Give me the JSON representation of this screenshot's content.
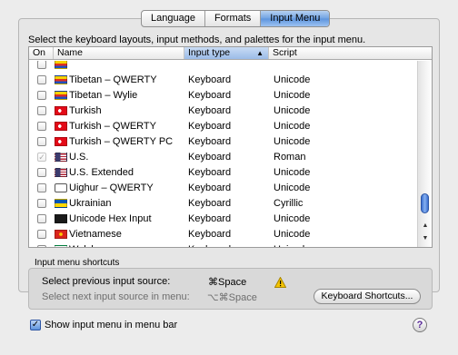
{
  "tabs": [
    {
      "label": "Language",
      "active": false
    },
    {
      "label": "Formats",
      "active": false
    },
    {
      "label": "Input Menu",
      "active": true
    }
  ],
  "instructions": "Select the keyboard layouts, input methods, and palettes for the input menu.",
  "table": {
    "columns": {
      "on": "On",
      "name": "Name",
      "input_type": "Input type",
      "script": "Script"
    },
    "sorted_column": "input_type",
    "rows": [
      {
        "checked": false,
        "disabled": false,
        "flag": "tibetan-flag-icon",
        "name": "",
        "input_type": "",
        "script": ""
      },
      {
        "checked": false,
        "disabled": false,
        "flag": "tibetan-flag-icon",
        "name": "Tibetan – QWERTY",
        "input_type": "Keyboard",
        "script": "Unicode"
      },
      {
        "checked": false,
        "disabled": false,
        "flag": "tibetan-flag-icon",
        "name": "Tibetan – Wylie",
        "input_type": "Keyboard",
        "script": "Unicode"
      },
      {
        "checked": false,
        "disabled": false,
        "flag": "turkey-flag-icon",
        "name": "Turkish",
        "input_type": "Keyboard",
        "script": "Unicode"
      },
      {
        "checked": false,
        "disabled": false,
        "flag": "turkey-flag-icon",
        "name": "Turkish – QWERTY",
        "input_type": "Keyboard",
        "script": "Unicode"
      },
      {
        "checked": false,
        "disabled": false,
        "flag": "turkey-flag-icon",
        "name": "Turkish – QWERTY PC",
        "input_type": "Keyboard",
        "script": "Unicode"
      },
      {
        "checked": true,
        "disabled": true,
        "flag": "us-flag-icon",
        "name": "U.S.",
        "input_type": "Keyboard",
        "script": "Roman"
      },
      {
        "checked": false,
        "disabled": false,
        "flag": "us-flag-icon",
        "name": "U.S. Extended",
        "input_type": "Keyboard",
        "script": "Unicode"
      },
      {
        "checked": false,
        "disabled": false,
        "flag": "uighur-flag-icon",
        "name": "Uighur – QWERTY",
        "input_type": "Keyboard",
        "script": "Unicode"
      },
      {
        "checked": false,
        "disabled": false,
        "flag": "ukraine-flag-icon",
        "name": "Ukrainian",
        "input_type": "Keyboard",
        "script": "Cyrillic"
      },
      {
        "checked": false,
        "disabled": false,
        "flag": "unicode-hex-icon",
        "name": "Unicode Hex Input",
        "input_type": "Keyboard",
        "script": "Unicode"
      },
      {
        "checked": false,
        "disabled": false,
        "flag": "vietnam-flag-icon",
        "name": "Vietnamese",
        "input_type": "Keyboard",
        "script": "Unicode"
      },
      {
        "checked": false,
        "disabled": false,
        "flag": "wales-flag-icon",
        "name": "Welsh",
        "input_type": "Keyboard",
        "script": "Unicode"
      }
    ]
  },
  "scrollbar": {
    "position": 0.95
  },
  "shortcuts": {
    "section_label": "Input menu shortcuts",
    "previous_label": "Select previous input source:",
    "previous_key": "⌘Space",
    "next_label": "Select next input source in menu:",
    "next_key": "⌥⌘Space",
    "button_label": "Keyboard Shortcuts..."
  },
  "show_in_menu_bar": {
    "label": "Show input menu in menu bar",
    "checked": true
  },
  "help_label": "?",
  "colors": {
    "accent": "#5d94dd",
    "warning": "#f5c400"
  }
}
